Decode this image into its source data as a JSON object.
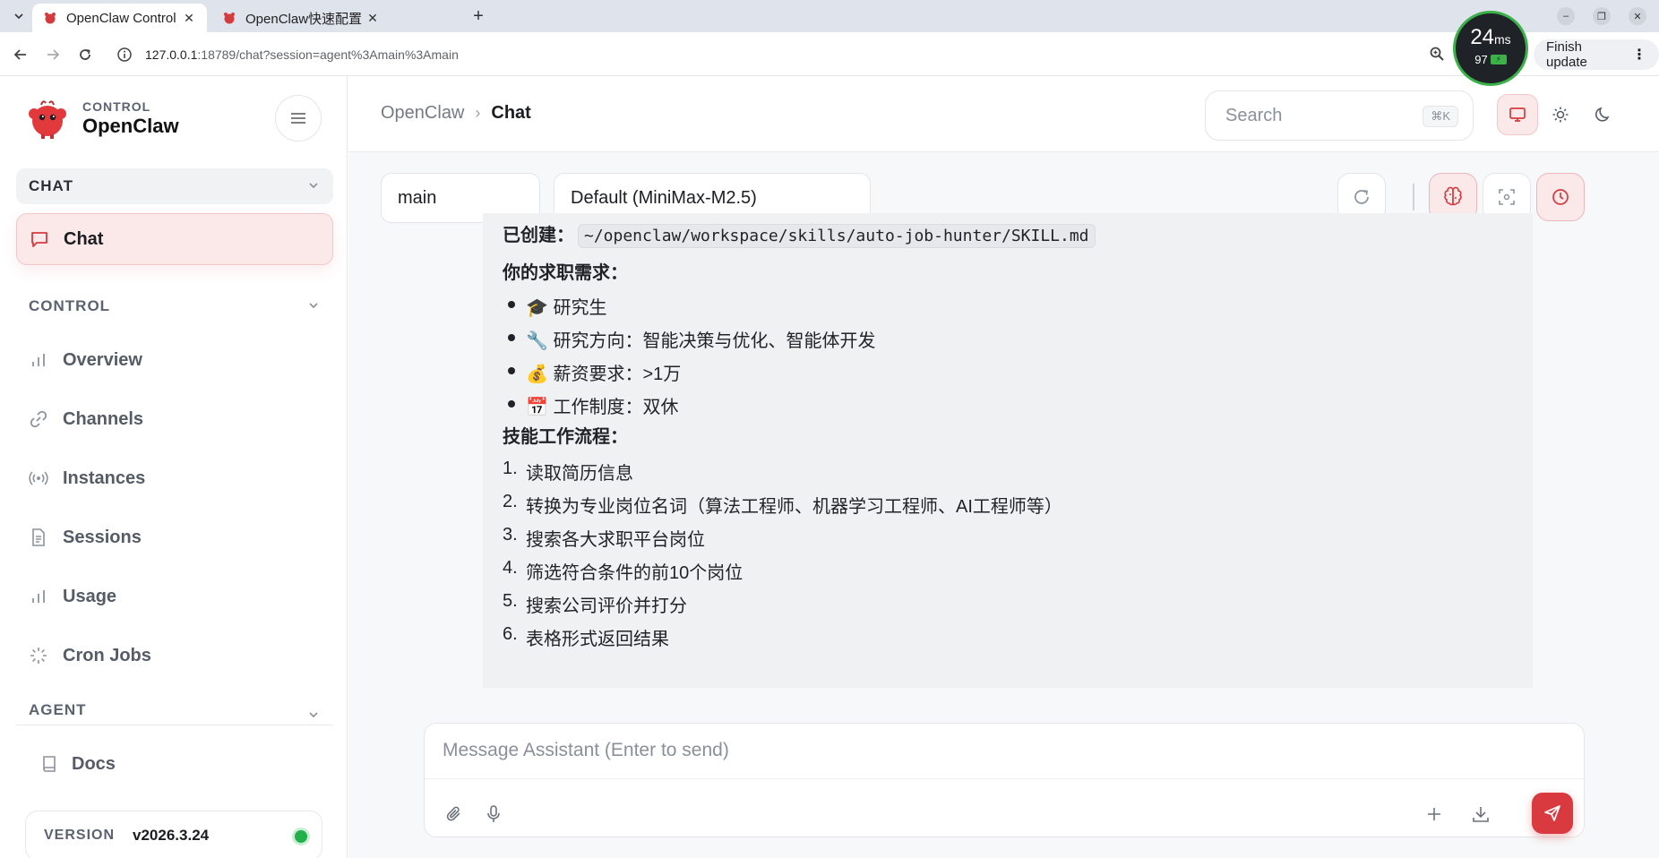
{
  "browser": {
    "tabs": [
      {
        "title": "OpenClaw Control",
        "active": true
      },
      {
        "title": "OpenClaw快速配置",
        "active": false
      }
    ],
    "url_host": "127.0.0.1",
    "url_rest": ":18789/chat?session=agent%3Amain%3Amain",
    "perf": {
      "latency": "24",
      "unit": "ms",
      "battery": "97"
    },
    "finish_update": "Finish update"
  },
  "sidebar": {
    "brand_kicker": "CONTROL",
    "brand_name": "OpenClaw",
    "sections": {
      "chat": "CHAT",
      "control": "CONTROL",
      "agent": "AGENT"
    },
    "chat_item": "Chat",
    "control_items": [
      "Overview",
      "Channels",
      "Instances",
      "Sessions",
      "Usage",
      "Cron Jobs"
    ],
    "docs": "Docs",
    "version_label": "VERSION",
    "version_value": "v2026.3.24"
  },
  "header": {
    "breadcrumb_root": "OpenClaw",
    "breadcrumb_sep": "›",
    "breadcrumb_current": "Chat",
    "search_placeholder": "Search",
    "search_shortcut": "⌘K"
  },
  "chat": {
    "session_select": "main",
    "model_select": "Default (MiniMax-M2.5)",
    "message": {
      "created_label": "已创建：",
      "created_path": "~/openclaw/workspace/skills/auto-job-hunter/SKILL.md",
      "needs_heading": "你的求职需求：",
      "needs": [
        "🎓 研究生",
        "🔧 研究方向：智能决策与优化、智能体开发",
        "💰 薪资要求：>1万",
        "📅 工作制度：双休"
      ],
      "workflow_heading": "技能工作流程：",
      "workflow": [
        "读取简历信息",
        "转换为专业岗位名词（算法工程师、机器学习工程师、AI工程师等）",
        "搜索各大求职平台岗位",
        "筛选符合条件的前10个岗位",
        "搜索公司评价并打分",
        "表格形式返回结果"
      ],
      "workflow_numbers": [
        "1.",
        "2.",
        "3.",
        "4.",
        "5.",
        "6."
      ]
    },
    "composer_placeholder": "Message Assistant (Enter to send)"
  },
  "colors": {
    "accent": "#d93a3f",
    "accent_soft": "#fbe9ea",
    "status_ok": "#22b04b"
  }
}
